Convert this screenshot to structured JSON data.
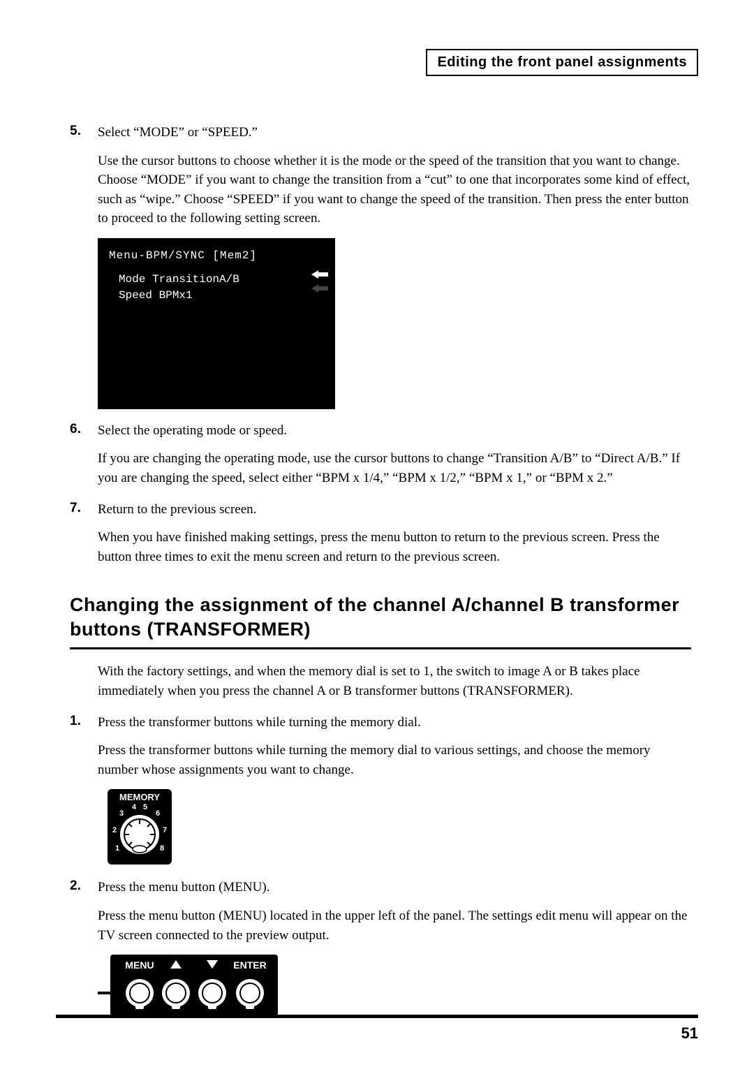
{
  "header": "Editing the front panel assignments",
  "steps_top": [
    {
      "num": "5.",
      "title": "Select “MODE” or “SPEED.”",
      "body": "Use the cursor buttons to choose whether it is the mode or the speed of the transition that you want to change. Choose “MODE” if you want to change the transition from a “cut” to one that incorporates some kind of effect, such as “wipe.” Choose “SPEED” if you want to change the speed of the transition. Then press the enter button to proceed to the following setting screen."
    }
  ],
  "lcd": {
    "line1": "Menu-BPM/SYNC   [Mem2]",
    "line2": "Mode  TransitionA/B",
    "line3": "Speed BPMx1"
  },
  "steps_mid": [
    {
      "num": "6.",
      "title": "Select the operating mode or speed.",
      "body": "If you are changing the operating mode, use the cursor buttons to change “Transition A/B” to “Direct A/B.” If you are changing the speed, select either “BPM x 1/4,” “BPM x 1/2,” “BPM x 1,” or “BPM x 2.”"
    },
    {
      "num": "7.",
      "title": "Return to the previous screen.",
      "body": "When you have finished making settings, press the menu button to return to the previous screen. Press the button three times to exit the menu screen and return to the previous screen."
    }
  ],
  "section_heading": "Changing the assignment of the channel A/channel B transformer buttons (TRANSFORMER)",
  "intro": "With the factory settings, and when the memory dial is set to 1, the switch to image A or B takes place immediately when you press the channel A or B transformer buttons (TRANSFORMER).",
  "steps_bottom": [
    {
      "num": "1.",
      "title": "Press the transformer buttons while turning the memory dial.",
      "body": "Press the transformer buttons while turning the memory dial to various settings, and choose the memory number whose assignments you want to change."
    },
    {
      "num": "2.",
      "title": "Press the menu button (MENU).",
      "body": "Press the menu button (MENU) located in the upper left of the panel. The settings edit menu will appear on the TV screen connected to the preview output."
    }
  ],
  "dial_label": "MEMORY",
  "menu_labels": {
    "menu": "MENU",
    "enter": "ENTER"
  },
  "page_number": "51"
}
